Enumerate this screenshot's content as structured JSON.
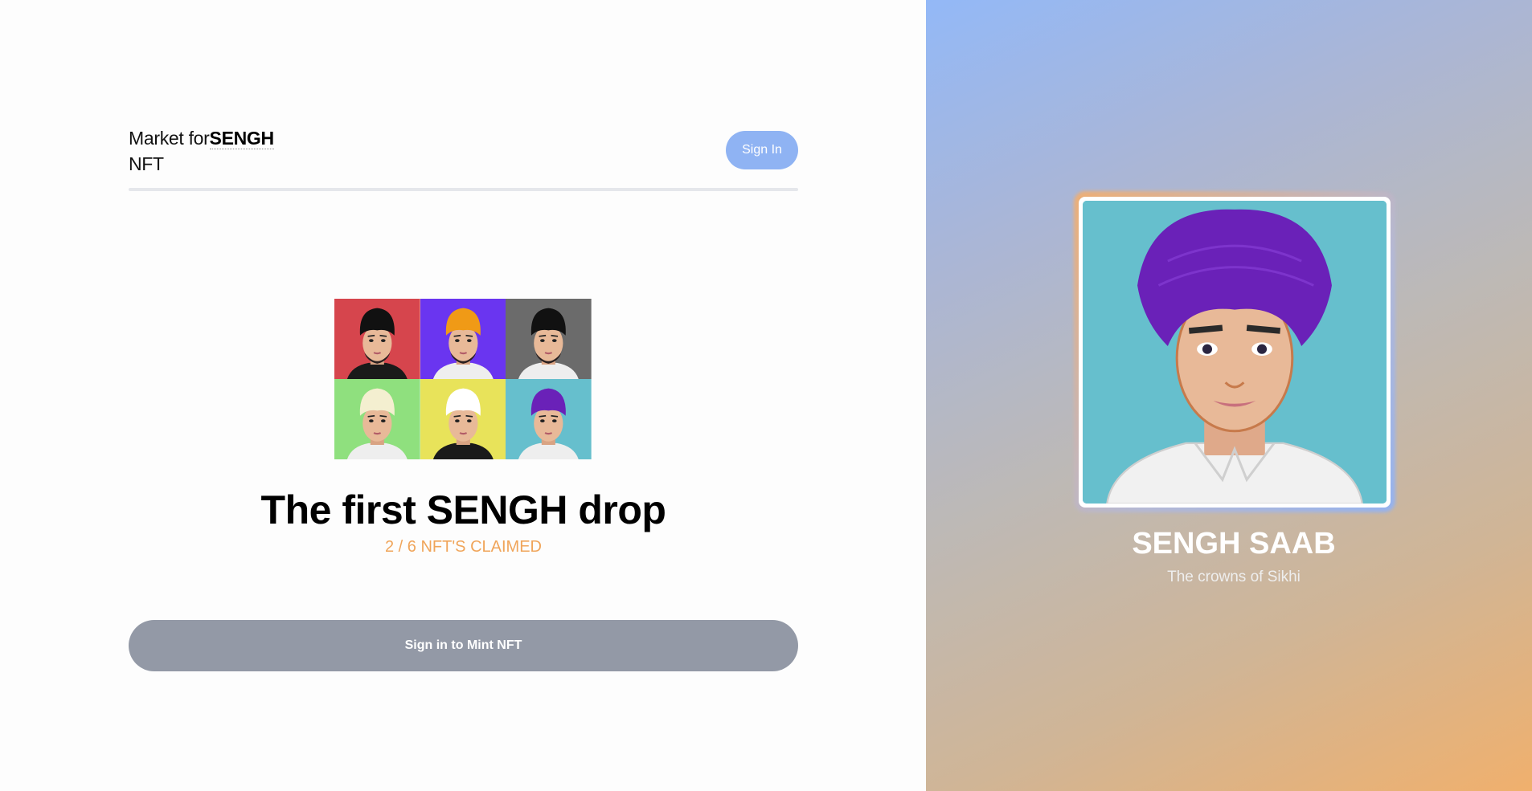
{
  "header": {
    "brand_prefix": "Market for",
    "brand_bold": "SENGH",
    "brand_suffix": "NFT",
    "signin_label": "Sign In"
  },
  "drop": {
    "title": "The first SENGH drop",
    "claimed": "2 / 6 NFT'S CLAIMED",
    "mint_label": "Sign in to Mint NFT",
    "tiles": [
      {
        "bg": "#d6454d",
        "turban": "#111111",
        "beard": true,
        "shirt": "#1a1a1a"
      },
      {
        "bg": "#6a35f0",
        "turban": "#f09a16",
        "beard": true,
        "shirt": "#eeeeee"
      },
      {
        "bg": "#6b6b6b",
        "turban": "#111111",
        "beard": true,
        "shirt": "#eeeeee"
      },
      {
        "bg": "#8fe07e",
        "turban": "#f4efd0",
        "beard": false,
        "shirt": "#eeeeee"
      },
      {
        "bg": "#e8e35a",
        "turban": "#ffffff",
        "beard": false,
        "shirt": "#1a1a1a"
      },
      {
        "bg": "#66bfcd",
        "turban": "#6a21b8",
        "beard": false,
        "shirt": "#eeeeee"
      }
    ]
  },
  "featured": {
    "title": "SENGH SAAB",
    "subtitle": "The crowns of Sikhi",
    "bg": "#66bfcd",
    "turban": "#6a21b8"
  },
  "colors": {
    "accent": "#f0a55a",
    "signin_bg": "#8fb3f3",
    "mint_bg": "#9399a6"
  }
}
